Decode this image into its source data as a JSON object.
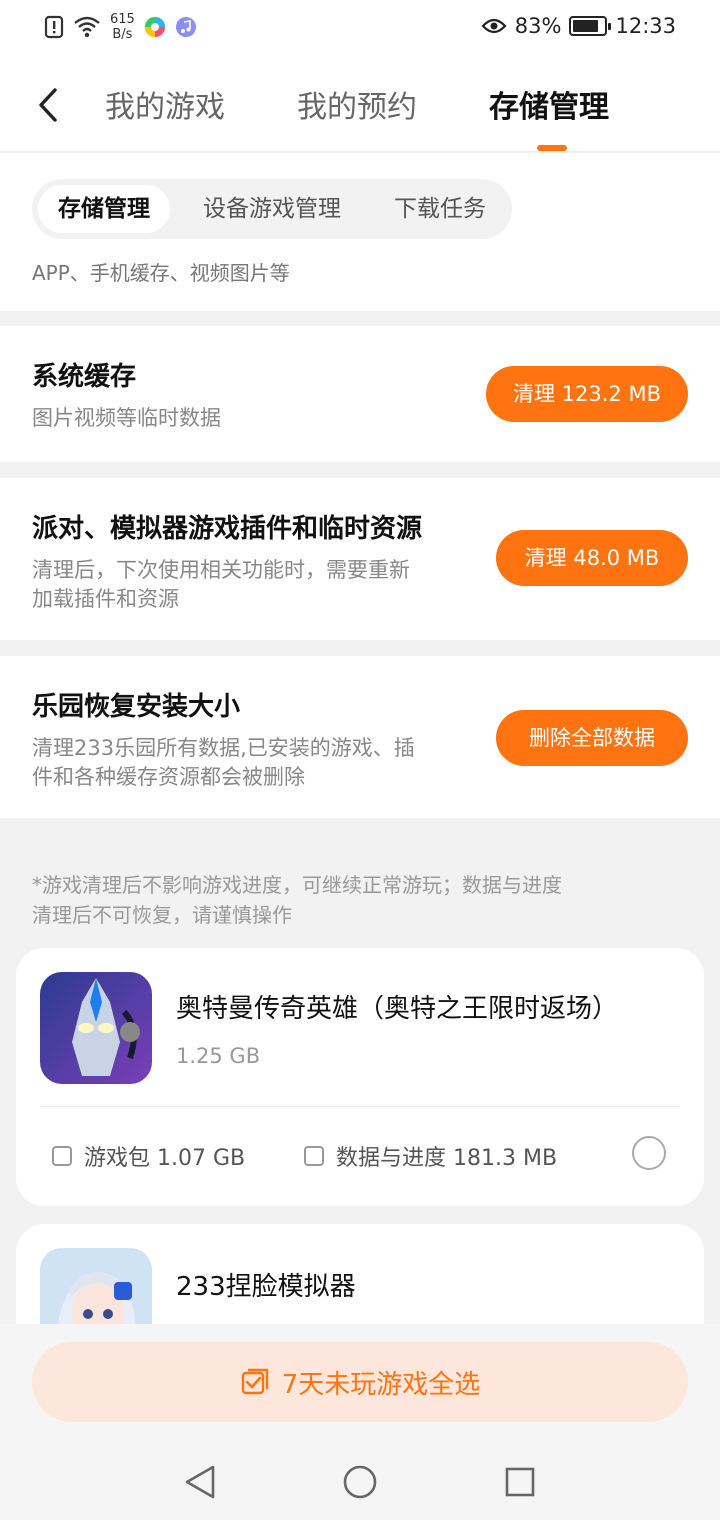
{
  "status_bar": {
    "net_speed": "615",
    "net_unit": "B/s",
    "battery_percent": "83%",
    "battery_level": 0.83,
    "time": "12:33"
  },
  "header": {
    "tabs": [
      {
        "label": "我的游戏"
      },
      {
        "label": "我的预约"
      },
      {
        "label": "存储管理"
      }
    ],
    "active_tab": 2,
    "accent_color": "#ff7310"
  },
  "sub_tabs": {
    "items": [
      {
        "label": "存储管理"
      },
      {
        "label": "设备游戏管理"
      },
      {
        "label": "下载任务"
      }
    ],
    "active": 0,
    "description": "APP、手机缓存、视频图片等"
  },
  "storage_rows": [
    {
      "title": "系统缓存",
      "desc_line1": "图片视频等临时数据",
      "desc_line2": "",
      "button": "清理 123.2 MB"
    },
    {
      "title": "派对、模拟器游戏插件和临时资源",
      "desc_line1": "清理后，下次使用相关功能时，需要重新",
      "desc_line2": "加载插件和资源",
      "button": "清理 48.0 MB"
    },
    {
      "title": "乐园恢复安装大小",
      "desc_line1": "清理233乐园所有数据,已安装的游戏、插",
      "desc_line2": "件和各种缓存资源都会被删除",
      "button": "删除全部数据"
    }
  ],
  "note": {
    "line1": "*游戏清理后不影响游戏进度，可继续正常游玩；数据与进度",
    "line2": "清理后不可恢复，请谨慎操作"
  },
  "games": [
    {
      "name": "奥特曼传奇英雄（奥特之王限时返场）",
      "size": "1.25 GB",
      "icon": "ultraman-game-icon",
      "option_pkg": "游戏包 1.07 GB",
      "option_data": "数据与进度 181.3 MB"
    },
    {
      "name": "233捏脸模拟器",
      "icon": "face-sim-game-icon"
    }
  ],
  "select_all": {
    "label": "7天未玩游戏全选",
    "icon": "checklist-icon"
  },
  "nav": {
    "back": "nav-back-icon",
    "home": "nav-home-icon",
    "recents": "nav-recents-icon"
  }
}
